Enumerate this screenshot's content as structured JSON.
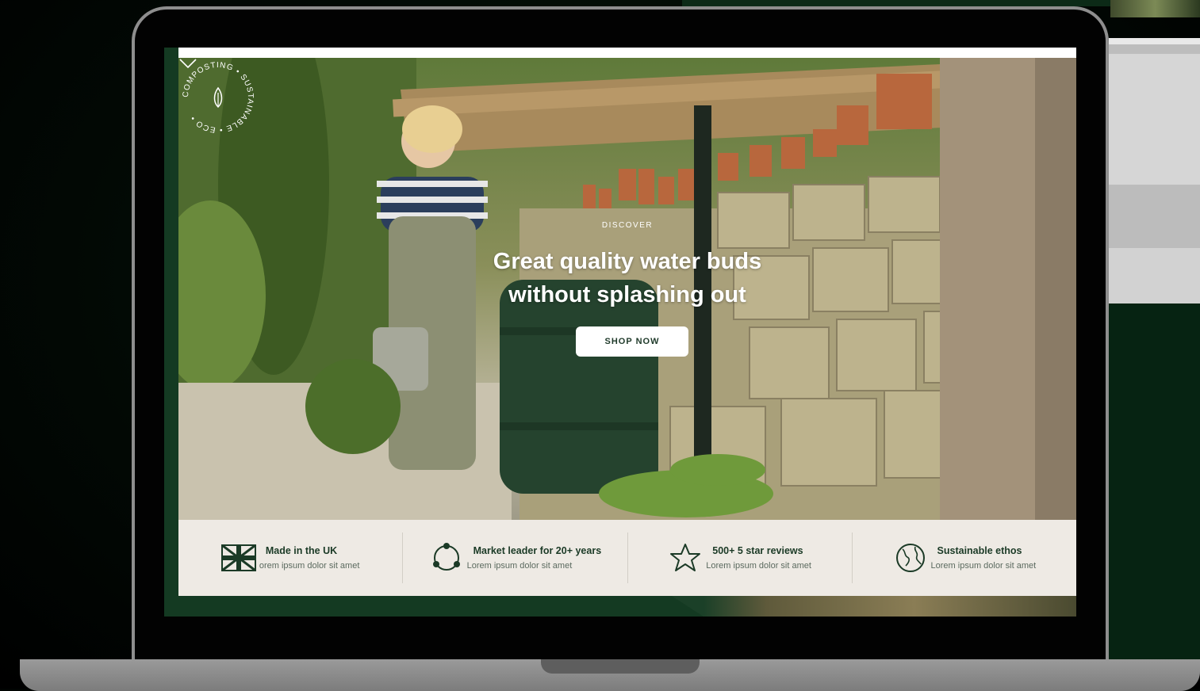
{
  "hero": {
    "eyebrow": "DISCOVER",
    "headline_line1": "Great quality water buds",
    "headline_line2": "without splashing out",
    "cta_label": "SHOP NOW",
    "badge_text": "COMPOSTING • SUSTAINABLE • ECO •"
  },
  "trust_bar": {
    "items": [
      {
        "title": "Made in the UK",
        "subtitle": "orem ipsum dolor sit amet",
        "icon": "uk-flag-icon"
      },
      {
        "title": "Market leader for 20+ years",
        "subtitle": "Lorem ipsum dolor sit amet",
        "icon": "cycle-icon"
      },
      {
        "title": "500+ 5 star reviews",
        "subtitle": "Lorem ipsum dolor sit amet",
        "icon": "star-icon"
      },
      {
        "title": "Sustainable ethos",
        "subtitle": "Lorem ipsum dolor sit amet",
        "icon": "globe-icon"
      }
    ]
  },
  "colors": {
    "brand_green": "#1b3a26",
    "trust_bar_bg": "#eeeae4",
    "background": "#020a05"
  }
}
